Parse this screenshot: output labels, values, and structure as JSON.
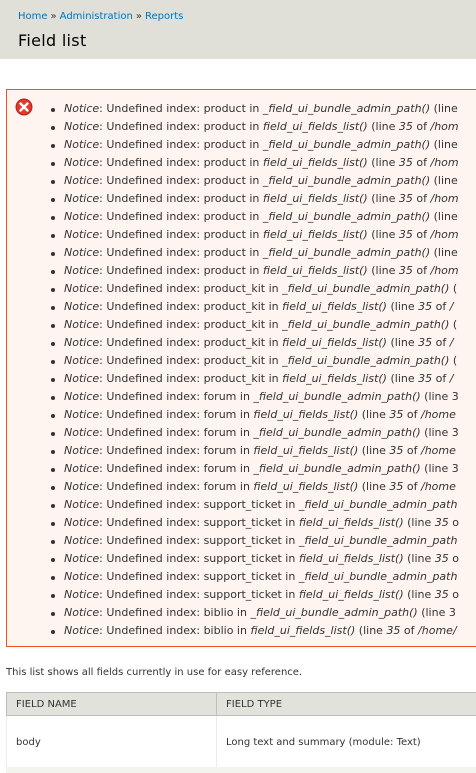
{
  "breadcrumb": {
    "items": [
      "Home",
      "Administration",
      "Reports"
    ],
    "separator": "»"
  },
  "page": {
    "title": "Field list"
  },
  "messages": {
    "type": "error",
    "icon": "error-icon",
    "items": [
      {
        "label": "Notice",
        "pre": ": Undefined index: product in ",
        "fn": "_field_ui_bundle_admin_path()",
        "post": " (line"
      },
      {
        "label": "Notice",
        "pre": ": Undefined index: product in ",
        "fn": "field_ui_fields_list()",
        "post": " (line ",
        "line": "35",
        "of": " of ",
        "path": "/hom"
      },
      {
        "label": "Notice",
        "pre": ": Undefined index: product in ",
        "fn": "_field_ui_bundle_admin_path()",
        "post": " (line"
      },
      {
        "label": "Notice",
        "pre": ": Undefined index: product in ",
        "fn": "field_ui_fields_list()",
        "post": " (line ",
        "line": "35",
        "of": " of ",
        "path": "/hom"
      },
      {
        "label": "Notice",
        "pre": ": Undefined index: product in ",
        "fn": "_field_ui_bundle_admin_path()",
        "post": " (line"
      },
      {
        "label": "Notice",
        "pre": ": Undefined index: product in ",
        "fn": "field_ui_fields_list()",
        "post": " (line ",
        "line": "35",
        "of": " of ",
        "path": "/hom"
      },
      {
        "label": "Notice",
        "pre": ": Undefined index: product in ",
        "fn": "_field_ui_bundle_admin_path()",
        "post": " (line"
      },
      {
        "label": "Notice",
        "pre": ": Undefined index: product in ",
        "fn": "field_ui_fields_list()",
        "post": " (line ",
        "line": "35",
        "of": " of ",
        "path": "/hom"
      },
      {
        "label": "Notice",
        "pre": ": Undefined index: product in ",
        "fn": "_field_ui_bundle_admin_path()",
        "post": " (line"
      },
      {
        "label": "Notice",
        "pre": ": Undefined index: product in ",
        "fn": "field_ui_fields_list()",
        "post": " (line ",
        "line": "35",
        "of": " of ",
        "path": "/hom"
      },
      {
        "label": "Notice",
        "pre": ": Undefined index: product_kit in ",
        "fn": "_field_ui_bundle_admin_path()",
        "post": " ("
      },
      {
        "label": "Notice",
        "pre": ": Undefined index: product_kit in ",
        "fn": "field_ui_fields_list()",
        "post": " (line ",
        "line": "35",
        "of": " of ",
        "path": "/"
      },
      {
        "label": "Notice",
        "pre": ": Undefined index: product_kit in ",
        "fn": "_field_ui_bundle_admin_path()",
        "post": " ("
      },
      {
        "label": "Notice",
        "pre": ": Undefined index: product_kit in ",
        "fn": "field_ui_fields_list()",
        "post": " (line ",
        "line": "35",
        "of": " of ",
        "path": "/"
      },
      {
        "label": "Notice",
        "pre": ": Undefined index: product_kit in ",
        "fn": "_field_ui_bundle_admin_path()",
        "post": " ("
      },
      {
        "label": "Notice",
        "pre": ": Undefined index: product_kit in ",
        "fn": "field_ui_fields_list()",
        "post": " (line ",
        "line": "35",
        "of": " of ",
        "path": "/"
      },
      {
        "label": "Notice",
        "pre": ": Undefined index: forum in ",
        "fn": "_field_ui_bundle_admin_path()",
        "post": " (line 3"
      },
      {
        "label": "Notice",
        "pre": ": Undefined index: forum in ",
        "fn": "field_ui_fields_list()",
        "post": " (line ",
        "line": "35",
        "of": " of ",
        "path": "/home"
      },
      {
        "label": "Notice",
        "pre": ": Undefined index: forum in ",
        "fn": "_field_ui_bundle_admin_path()",
        "post": " (line 3"
      },
      {
        "label": "Notice",
        "pre": ": Undefined index: forum in ",
        "fn": "field_ui_fields_list()",
        "post": " (line ",
        "line": "35",
        "of": " of ",
        "path": "/home"
      },
      {
        "label": "Notice",
        "pre": ": Undefined index: forum in ",
        "fn": "_field_ui_bundle_admin_path()",
        "post": " (line 3"
      },
      {
        "label": "Notice",
        "pre": ": Undefined index: forum in ",
        "fn": "field_ui_fields_list()",
        "post": " (line ",
        "line": "35",
        "of": " of ",
        "path": "/home"
      },
      {
        "label": "Notice",
        "pre": ": Undefined index: support_ticket in ",
        "fn": "_field_ui_bundle_admin_path",
        "post": ""
      },
      {
        "label": "Notice",
        "pre": ": Undefined index: support_ticket in ",
        "fn": "field_ui_fields_list()",
        "post": " (line ",
        "line": "35",
        "of": " o",
        "path": ""
      },
      {
        "label": "Notice",
        "pre": ": Undefined index: support_ticket in ",
        "fn": "_field_ui_bundle_admin_path",
        "post": ""
      },
      {
        "label": "Notice",
        "pre": ": Undefined index: support_ticket in ",
        "fn": "field_ui_fields_list()",
        "post": " (line ",
        "line": "35",
        "of": " o",
        "path": ""
      },
      {
        "label": "Notice",
        "pre": ": Undefined index: support_ticket in ",
        "fn": "_field_ui_bundle_admin_path",
        "post": ""
      },
      {
        "label": "Notice",
        "pre": ": Undefined index: support_ticket in ",
        "fn": "field_ui_fields_list()",
        "post": " (line ",
        "line": "35",
        "of": " o",
        "path": ""
      },
      {
        "label": "Notice",
        "pre": ": Undefined index: biblio in ",
        "fn": "_field_ui_bundle_admin_path()",
        "post": " (line 3"
      },
      {
        "label": "Notice",
        "pre": ": Undefined index: biblio in ",
        "fn": "field_ui_fields_list()",
        "post": " (line ",
        "line": "35",
        "of": " of ",
        "path": "/home/"
      }
    ]
  },
  "intro": "This list shows all fields currently in use for easy reference.",
  "table": {
    "headers": [
      "FIELD NAME",
      "FIELD TYPE"
    ],
    "rows": [
      [
        "body",
        "Long text and summary (module: Text)"
      ]
    ]
  }
}
